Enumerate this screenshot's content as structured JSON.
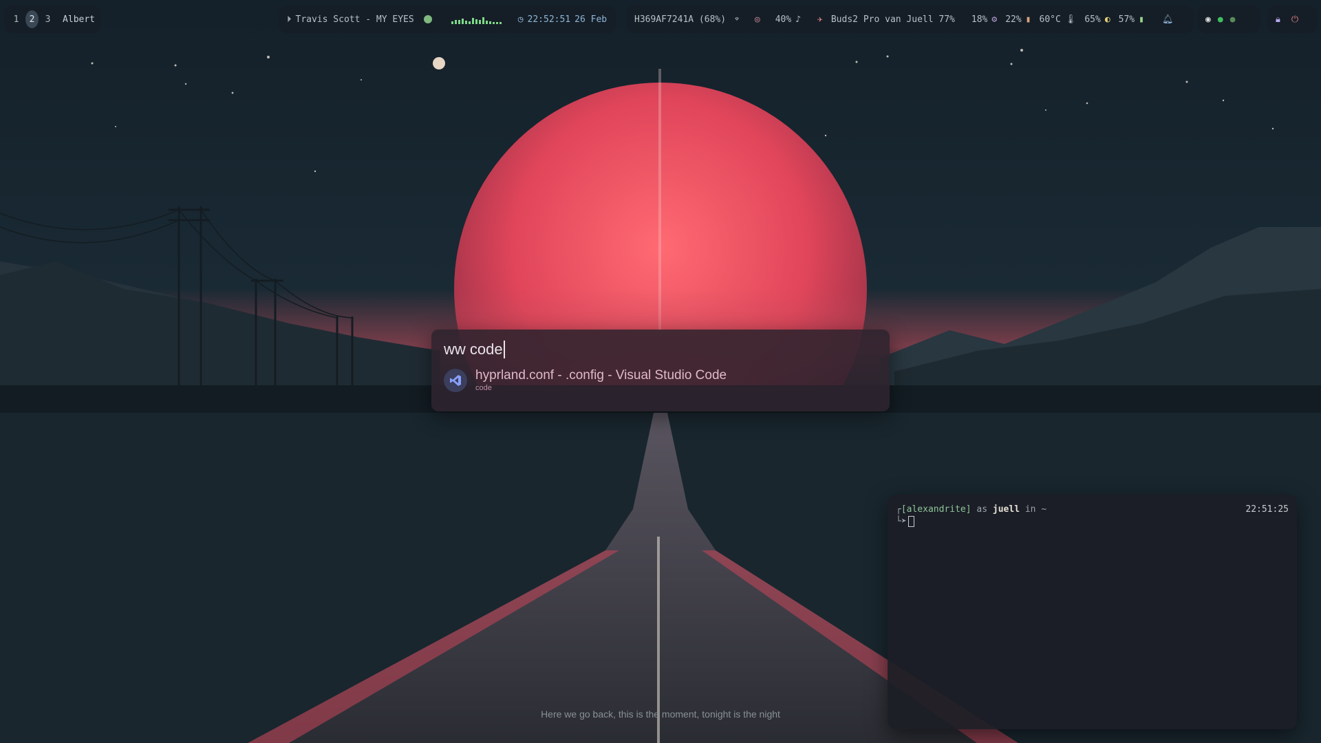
{
  "workspaces": [
    "1",
    "2",
    "3"
  ],
  "active_workspace": "2",
  "window_title": "Albert",
  "media": {
    "track": "Travis Scott - MY EYES"
  },
  "clock": {
    "time": "22:52:51",
    "date": "26 Feb"
  },
  "network": {
    "ssid": "H369AF7241A (68%)"
  },
  "status": {
    "volume": "40%",
    "bluetooth": "Buds2 Pro van Juell 77%",
    "cpu": "18%",
    "mem": "22%",
    "temp": "60°C",
    "brightness": "65%",
    "battery": "57%"
  },
  "launcher": {
    "query": "ww code",
    "result_title": "hyprland.conf - .config - Visual Studio Code",
    "result_sub": "code"
  },
  "terminal": {
    "host": "[alexandrite]",
    "as": "as",
    "user": "juell",
    "in": "in ~",
    "time": "22:51:25"
  },
  "lyric": "Here we go back, this is the moment, tonight is the night",
  "colors": {
    "moon": "#e04a5c",
    "road_glow": "#d1425a",
    "accent_green": "#7fd98a"
  }
}
